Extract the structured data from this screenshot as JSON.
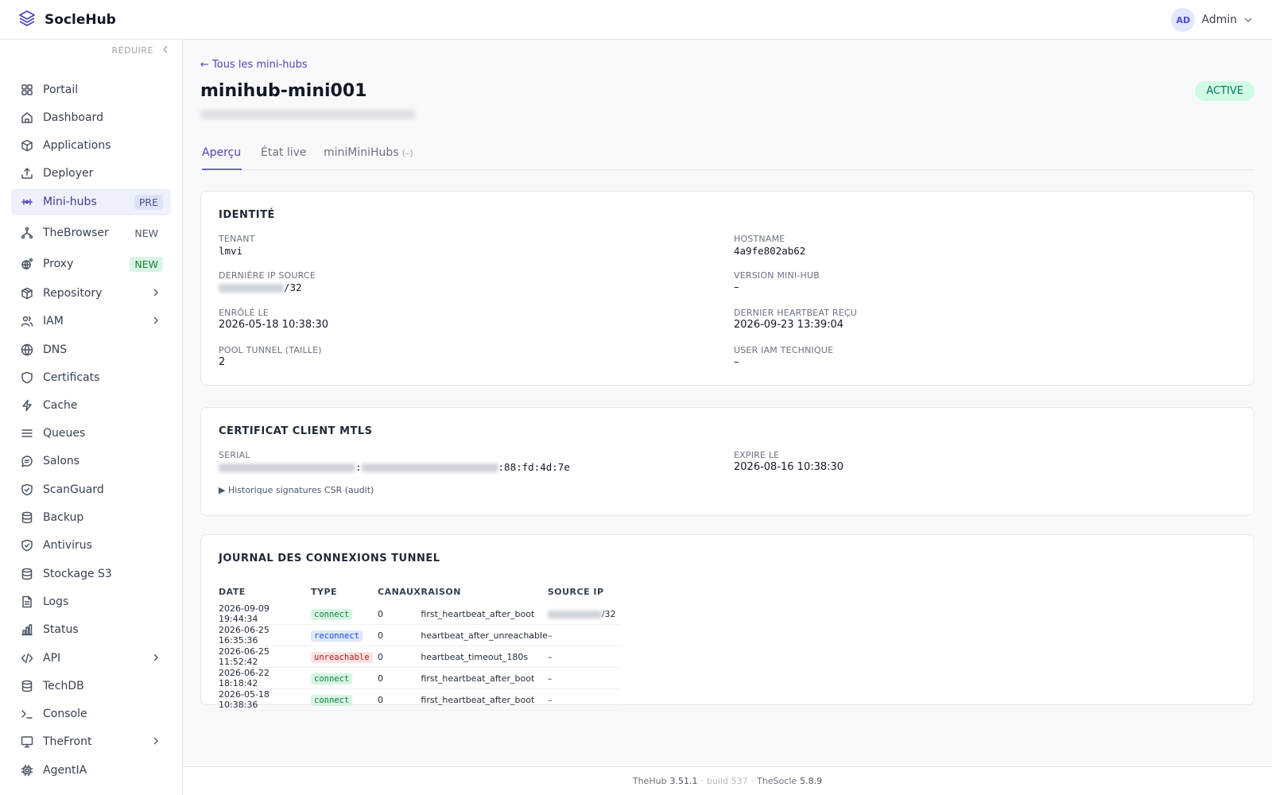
{
  "app": {
    "name": "SocleHub"
  },
  "user": {
    "initials": "AD",
    "name": "Admin"
  },
  "sidebar": {
    "collapse_label": "RÉDUIRE",
    "items": [
      {
        "label": "Portail",
        "icon": "grid-icon"
      },
      {
        "label": "Dashboard",
        "icon": "home-icon"
      },
      {
        "label": "Applications",
        "icon": "cube-icon"
      },
      {
        "label": "Deployer",
        "icon": "upload-icon"
      },
      {
        "label": "Mini-hubs",
        "icon": "sliders-icon",
        "badge": "PRE",
        "active": true
      },
      {
        "label": "TheBrowser",
        "icon": "network-icon",
        "badge": "NEW"
      },
      {
        "label": "Proxy",
        "icon": "proxy-icon",
        "badge": "NEW"
      },
      {
        "label": "Repository",
        "icon": "package-icon",
        "expandable": true
      },
      {
        "label": "IAM",
        "icon": "users-icon",
        "expandable": true
      },
      {
        "label": "DNS",
        "icon": "globe-icon"
      },
      {
        "label": "Certificats",
        "icon": "shield-icon"
      },
      {
        "label": "Cache",
        "icon": "bolt-icon"
      },
      {
        "label": "Queues",
        "icon": "list-icon"
      },
      {
        "label": "Salons",
        "icon": "chat-icon"
      },
      {
        "label": "ScanGuard",
        "icon": "shield-check-icon"
      },
      {
        "label": "Backup",
        "icon": "database-icon"
      },
      {
        "label": "Antivirus",
        "icon": "shield-check-icon"
      },
      {
        "label": "Stockage S3",
        "icon": "database-icon"
      },
      {
        "label": "Logs",
        "icon": "document-icon"
      },
      {
        "label": "Status",
        "icon": "bar-chart-icon"
      },
      {
        "label": "API",
        "icon": "code-icon",
        "expandable": true
      },
      {
        "label": "TechDB",
        "icon": "database-icon"
      },
      {
        "label": "Console",
        "icon": "terminal-icon"
      },
      {
        "label": "TheFront",
        "icon": "monitor-icon",
        "expandable": true
      },
      {
        "label": "AgentIA",
        "icon": "cpu-icon"
      }
    ]
  },
  "page": {
    "back_link": "← Tous les mini-hubs",
    "title": "minihub-mini001",
    "status": "ACTIVE",
    "tabs": [
      {
        "label": "Aperçu",
        "active": true
      },
      {
        "label": "État live"
      },
      {
        "label": "miniMiniHubs",
        "count": "(–)"
      }
    ]
  },
  "identity": {
    "heading": "IDENTITÉ",
    "tenant_label": "TENANT",
    "tenant_value": "lmvi",
    "hostname_label": "HOSTNAME",
    "hostname_value": "4a9fe802ab62",
    "ip_label": "DERNIÈRE IP SOURCE",
    "ip_suffix": "/32",
    "version_label": "VERSION MINI-HUB",
    "version_value": "–",
    "enrolled_label": "ENRÔLÉ LE",
    "enrolled_value": "2026-05-18 10:38:30",
    "heartbeat_label": "DERNIER HEARTBEAT REÇU",
    "heartbeat_value": "2026-09-23 13:39:04",
    "pool_label": "POOL TUNNEL (TAILLE)",
    "pool_value": "2",
    "iam_label": "USER IAM TECHNIQUE",
    "iam_value": "–"
  },
  "certificate": {
    "heading": "CERTIFICAT CLIENT MTLS",
    "serial_label": "SERIAL",
    "serial_sep": ":",
    "serial_suffix": ":88:fd:4d:7e",
    "expire_label": "EXPIRE LE",
    "expire_value": "2026-08-16 10:38:30",
    "history_toggle": "▶ Historique signatures CSR (audit)"
  },
  "journal": {
    "heading": "JOURNAL DES CONNEXIONS TUNNEL",
    "columns": [
      "DATE",
      "TYPE",
      "CANAUX",
      "RAISON",
      "SOURCE IP"
    ],
    "rows": [
      {
        "date": "2026-09-09 19:44:34",
        "type": "connect",
        "channels": "0",
        "reason": "first_heartbeat_after_boot",
        "source": "/32",
        "source_blurred": true
      },
      {
        "date": "2026-06-25 16:35:36",
        "type": "reconnect",
        "channels": "0",
        "reason": "heartbeat_after_unreachable",
        "source": "–"
      },
      {
        "date": "2026-06-25 11:52:42",
        "type": "unreachable",
        "channels": "0",
        "reason": "heartbeat_timeout_180s",
        "source": "–"
      },
      {
        "date": "2026-06-22 18:18:42",
        "type": "connect",
        "channels": "0",
        "reason": "first_heartbeat_after_boot",
        "source": "–"
      },
      {
        "date": "2026-05-18 10:38:36",
        "type": "connect",
        "channels": "0",
        "reason": "first_heartbeat_after_boot",
        "source": "–"
      }
    ]
  },
  "footer": {
    "product": "TheHub",
    "version": "3.51.1",
    "build": "build 537",
    "socle": "TheSocle",
    "socle_version": "5.8.9"
  }
}
